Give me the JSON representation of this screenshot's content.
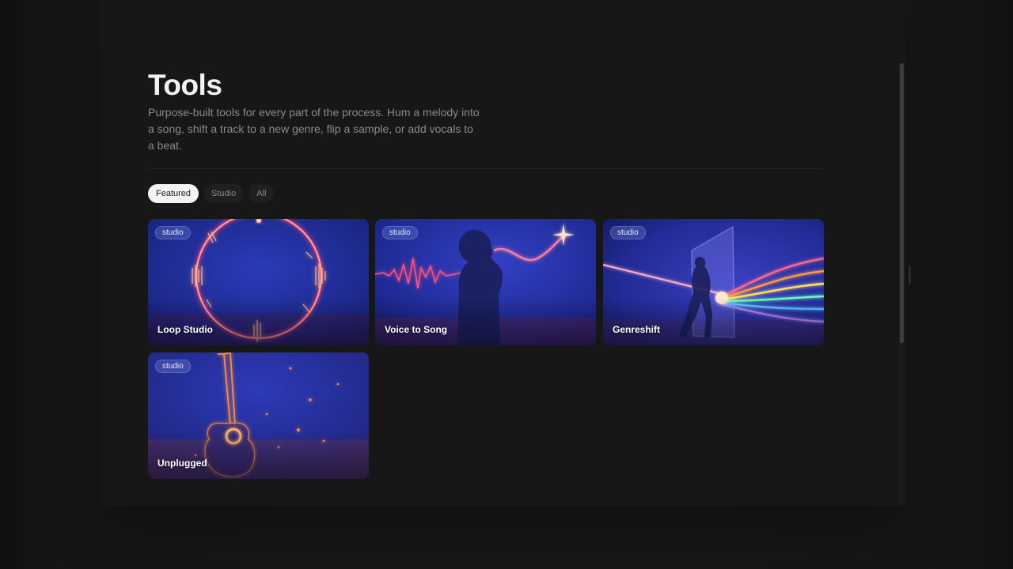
{
  "page": {
    "title": "Tools",
    "description": "Purpose-built tools for every part of the process. Hum a melody into a song, shift a track to a new genre, flip a sample, or add vocals to a beat."
  },
  "filters": [
    {
      "label": "Featured",
      "active": true
    },
    {
      "label": "Studio",
      "active": false
    },
    {
      "label": "All",
      "active": false
    }
  ],
  "tools": [
    {
      "name": "Loop Studio",
      "badge": "studio",
      "art": "glowing-ring-waveform"
    },
    {
      "name": "Voice to Song",
      "badge": "studio",
      "art": "singer-silhouette-waveform"
    },
    {
      "name": "Genreshift",
      "badge": "studio",
      "art": "portal-rainbow-waves"
    },
    {
      "name": "Unplugged",
      "badge": "studio",
      "art": "glowing-acoustic-guitar"
    }
  ],
  "colors": {
    "background": "#171717",
    "chip_active_bg": "#f3f3f3",
    "card_blue": "#23309a",
    "neon_pink": "#ff5aa0",
    "neon_orange": "#ff9a3c"
  }
}
